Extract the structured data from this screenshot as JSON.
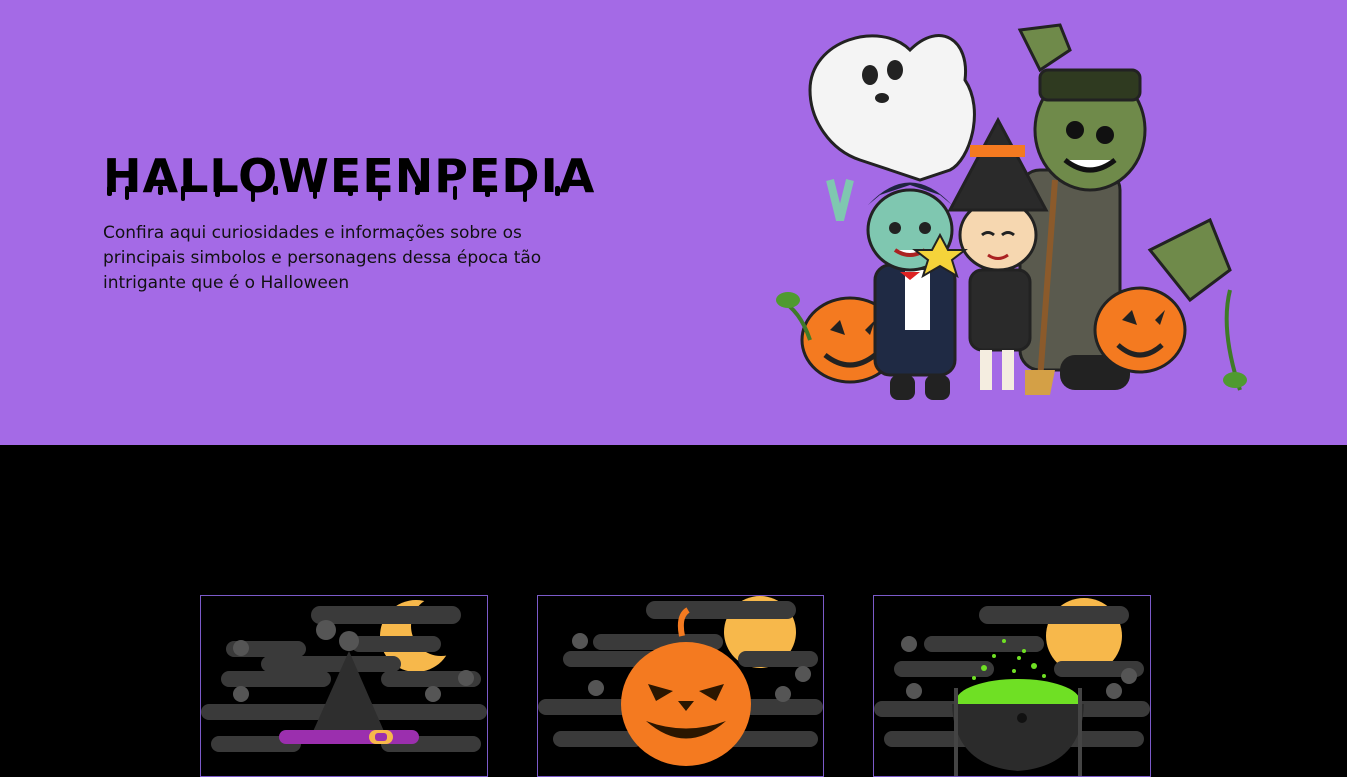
{
  "hero": {
    "title": "HALLOWEENPEDIA",
    "subtitle": "Confira aqui curiosidades e informações sobre os principais simbolos e personagens dessa época tão intrigante que é o Halloween",
    "illustration": "halloween-characters-illustration"
  },
  "cards": [
    {
      "icon": "witch-hat-icon"
    },
    {
      "icon": "pumpkin-icon"
    },
    {
      "icon": "cauldron-icon"
    }
  ],
  "colors": {
    "hero_bg": "#a46ae6",
    "dark_bg": "#000000",
    "card_border": "#7b5ac9",
    "moon": "#f7b84b",
    "cloud": "#3a3a3a",
    "pumpkin": "#f47a20",
    "potion": "#6fe024",
    "hat_band": "#9b2fae"
  }
}
